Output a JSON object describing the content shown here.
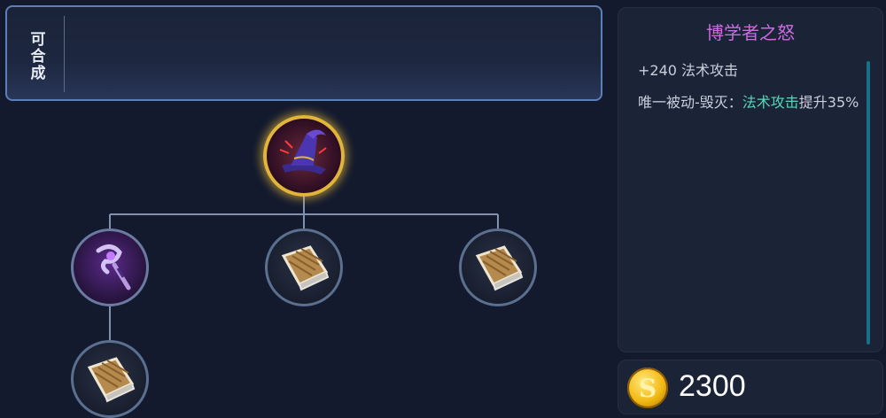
{
  "compose_panel": {
    "label": "可合成"
  },
  "item_tree": {
    "root": {
      "name": "博学者之怒",
      "icon": "wizard-hat-icon"
    },
    "children": [
      {
        "icon": "staff-icon"
      },
      {
        "icon": "book-icon"
      },
      {
        "icon": "book-icon"
      }
    ],
    "grandchildren": [
      {
        "icon": "book-icon"
      }
    ]
  },
  "info": {
    "title": "博学者之怒",
    "title_color": "#c96de0",
    "stat_line": "+240 法术攻击",
    "passive_prefix": "唯一被动-毁灭：",
    "passive_highlight": "法术攻击",
    "passive_suffix": "提升35%",
    "highlight_color": "#58d7b8"
  },
  "price": {
    "value": "2300",
    "currency_icon": "gold-coin-icon",
    "coin_letter": "S"
  }
}
